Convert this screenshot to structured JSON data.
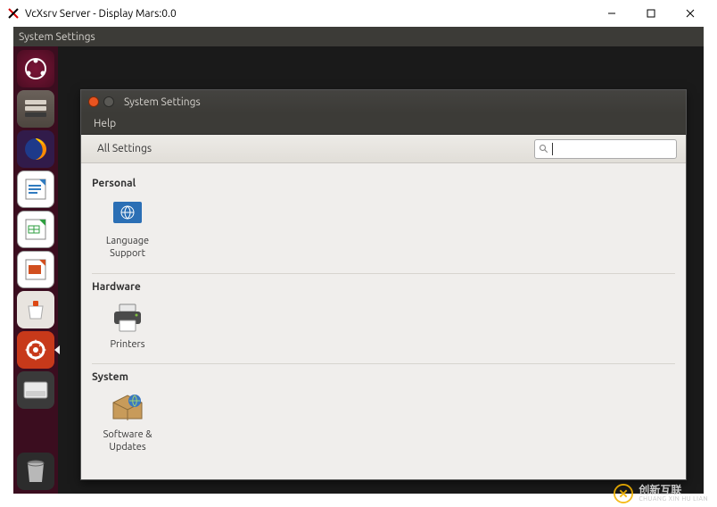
{
  "os_window": {
    "title": "VcXsrv Server - Display Mars:0.0"
  },
  "top_menubar": {
    "label": "System Settings"
  },
  "launcher": {
    "items": [
      {
        "name": "ubuntu-dash-icon"
      },
      {
        "name": "files-icon"
      },
      {
        "name": "firefox-icon"
      },
      {
        "name": "libreoffice-writer-icon"
      },
      {
        "name": "libreoffice-calc-icon"
      },
      {
        "name": "libreoffice-impress-icon"
      },
      {
        "name": "software-center-icon"
      },
      {
        "name": "system-settings-icon"
      },
      {
        "name": "disk-icon"
      }
    ],
    "trash": {
      "name": "trash-icon"
    }
  },
  "settings_window": {
    "title": "System Settings",
    "menu": {
      "help": "Help"
    },
    "toolbar": {
      "breadcrumb": "All Settings",
      "search_placeholder": ""
    },
    "sections": {
      "personal": {
        "title": "Personal",
        "items": [
          {
            "label": "Language Support"
          }
        ]
      },
      "hardware": {
        "title": "Hardware",
        "items": [
          {
            "label": "Printers"
          }
        ]
      },
      "system": {
        "title": "System",
        "items": [
          {
            "label": "Software & Updates"
          }
        ]
      }
    }
  },
  "watermark": {
    "brand": "创新互联",
    "pinyin": "CHUANG XIN HU LIAN"
  }
}
